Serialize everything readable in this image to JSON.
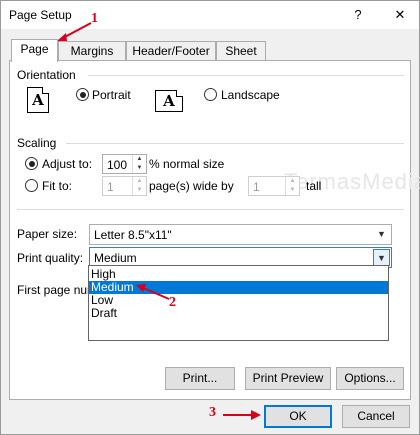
{
  "window": {
    "title": "Page Setup",
    "help_glyph": "?",
    "close_glyph": "✕"
  },
  "tabs": [
    {
      "label": "Page",
      "active": true
    },
    {
      "label": "Margins",
      "active": false
    },
    {
      "label": "Header/Footer",
      "active": false
    },
    {
      "label": "Sheet",
      "active": false
    }
  ],
  "orientation": {
    "section_label": "Orientation",
    "icon_glyph": "A",
    "portrait_label": "Portrait",
    "landscape_label": "Landscape",
    "selected": "portrait"
  },
  "watermark": "TermasMedia",
  "scaling": {
    "section_label": "Scaling",
    "adjust_to_label": "Adjust to:",
    "adjust_to_value": "100",
    "adjust_to_suffix": "% normal size",
    "fit_to_label": "Fit to:",
    "fit_wide_value": "1",
    "fit_wide_suffix": "page(s) wide by",
    "fit_tall_value": "1",
    "fit_tall_suffix": "tall",
    "selected": "adjust"
  },
  "paper_size": {
    "label": "Paper size:",
    "value": "Letter 8.5\"x11\""
  },
  "print_quality": {
    "label": "Print quality:",
    "value": "Medium",
    "options": [
      "High",
      "Medium",
      "Low",
      "Draft"
    ],
    "highlighted": "Medium"
  },
  "first_page_number": {
    "label": "First page num"
  },
  "buttons": {
    "print": "Print...",
    "print_preview": "Print Preview",
    "options": "Options...",
    "ok": "OK",
    "cancel": "Cancel"
  },
  "annotations": {
    "step1": "1",
    "step2": "2",
    "step3": "3",
    "color": "#d6001c"
  },
  "colors": {
    "selection": "#0078d7",
    "dialog_bg": "#f0f0f0",
    "panel_bg": "#ffffff"
  }
}
